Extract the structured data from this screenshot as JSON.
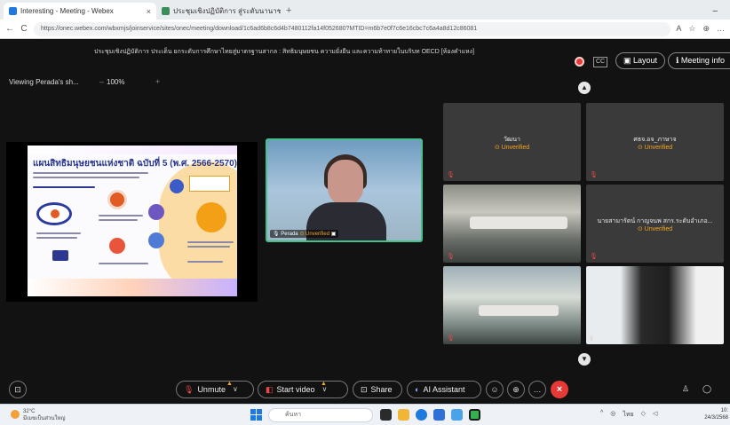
{
  "browser": {
    "tabs": [
      {
        "label": "Interesting - Meeting - Webex",
        "close": "×"
      },
      {
        "label": "ประชุมเชิงปฏิบัติการ สู่ระดับนานาชาติ",
        "close": "×"
      }
    ],
    "new_tab": "+",
    "minimize": "–",
    "url": "https://onec.webex.com/wbxmjs/joinservice/sites/onec/meeting/download/1c6ad6b8c6d4b7480112fa14f052680?MTID=m6b7e0f7c6e16cbc7c6a4a8d12c86081",
    "back": "←",
    "reload": "C",
    "tool_icons": [
      "A",
      "☆",
      "⊕",
      "…"
    ]
  },
  "meeting": {
    "title": "ประชุมเชิงปฏิบัติการ ประเด็น ยกระดับการศึกษาไทยสู่มาตรฐานสากล : สิทธิมนุษยชน ความยั่งยืน และความท้าทายในบริบท OECD [ห้องคำแหง]",
    "cc_label": "CC",
    "layout_label": "Layout",
    "meeting_info_label": "Meeting info",
    "viewing_label": "Viewing Perada's sh...",
    "zoom_level": "100%",
    "zoom_minus": "–",
    "zoom_plus": "+",
    "poster_title": "แผนสิทธิมนุษยชนแห่งชาติ ฉบับที่ 5 (พ.ศ. 2566-2570)",
    "speaker": {
      "name": "Perada",
      "status": "Unverified"
    },
    "participants": [
      {
        "name": "วัฒนา",
        "status": "⊙ Unverified"
      },
      {
        "name": "ศธจ.อจ_ภาษาจ",
        "status": "⊙ Unverified"
      },
      {
        "name": "นายสามารัตน์ กาญจนพ สกร.ระดับอำเภอ...",
        "status": "⊙ Unverified"
      }
    ],
    "controls": {
      "unmute": "Unmute",
      "start_video": "Start video",
      "share": "Share",
      "ai_assistant": "AI Assistant"
    }
  },
  "taskbar": {
    "weather_temp": "32°C",
    "weather_desc": "มีเมฆเป็นส่วนใหญ่",
    "search_placeholder": "ค้นหา",
    "tray_text": "ไทย",
    "clock_time": "10:",
    "clock_date": "24/3/2568"
  },
  "colors": {
    "accent_green": "#46c08a",
    "record_red": "#e53935",
    "warning_orange": "#f5a623",
    "windows_blue": "#1f7ae0"
  }
}
